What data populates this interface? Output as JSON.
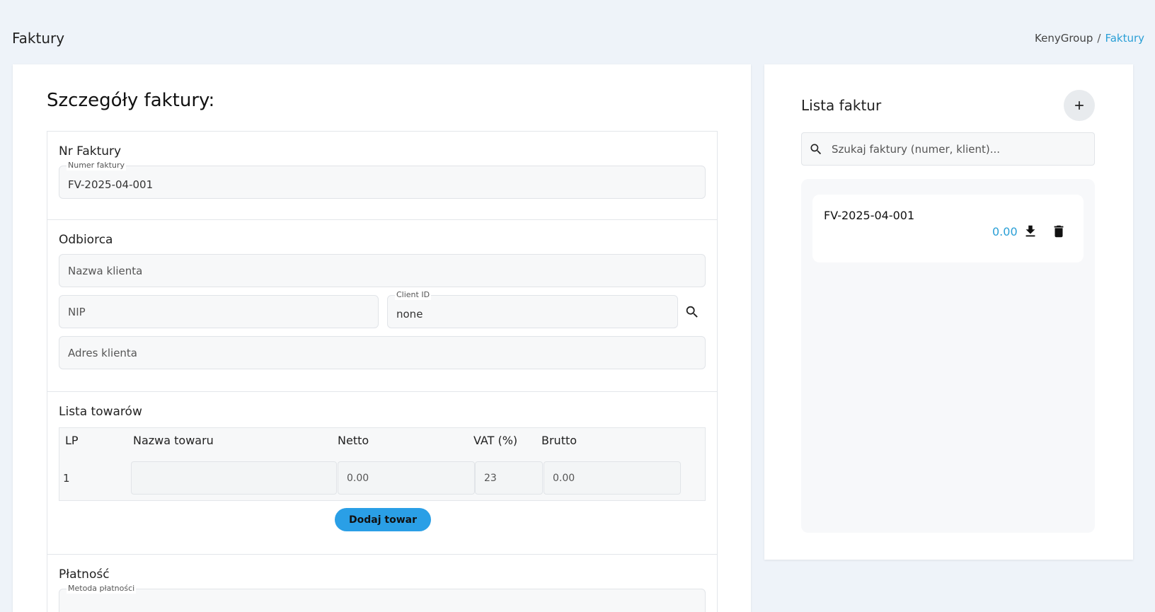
{
  "header": {
    "title": "Faktury",
    "breadcrumb": {
      "root": "KenyGroup",
      "separator": "/",
      "current": "Faktury"
    }
  },
  "details": {
    "heading": "Szczegóły faktury:",
    "invoice_number_section": {
      "title": "Nr Faktury",
      "field_label": "Numer faktury",
      "value": "FV-2025-04-001"
    },
    "recipient_section": {
      "title": "Odbiorca",
      "client_name_placeholder": "Nazwa klienta",
      "nip_placeholder": "NIP",
      "client_id_label": "Client ID",
      "client_id_value": "none",
      "address_placeholder": "Adres klienta"
    },
    "items_section": {
      "title": "Lista towarów",
      "columns": [
        "LP",
        "Nazwa towaru",
        "Netto",
        "VAT (%)",
        "Brutto"
      ],
      "rows": [
        {
          "lp": "1",
          "name": "",
          "netto": "0.00",
          "vat": "23",
          "brutto": "0.00"
        }
      ],
      "add_button": "Dodaj towar"
    },
    "payment_section": {
      "title": "Płatność",
      "method_label": "Metoda płatności"
    }
  },
  "invoice_list": {
    "title": "Lista faktur",
    "search_placeholder": "Szukaj faktury (numer, klient)...",
    "items": [
      {
        "number": "FV-2025-04-001",
        "amount": "0.00"
      }
    ]
  },
  "colors": {
    "accent": "#2a9fd6",
    "button": "#2a9fe6",
    "background": "#eef3f9"
  },
  "icons": [
    "search-icon",
    "plus-icon",
    "download-icon",
    "delete-icon"
  ]
}
